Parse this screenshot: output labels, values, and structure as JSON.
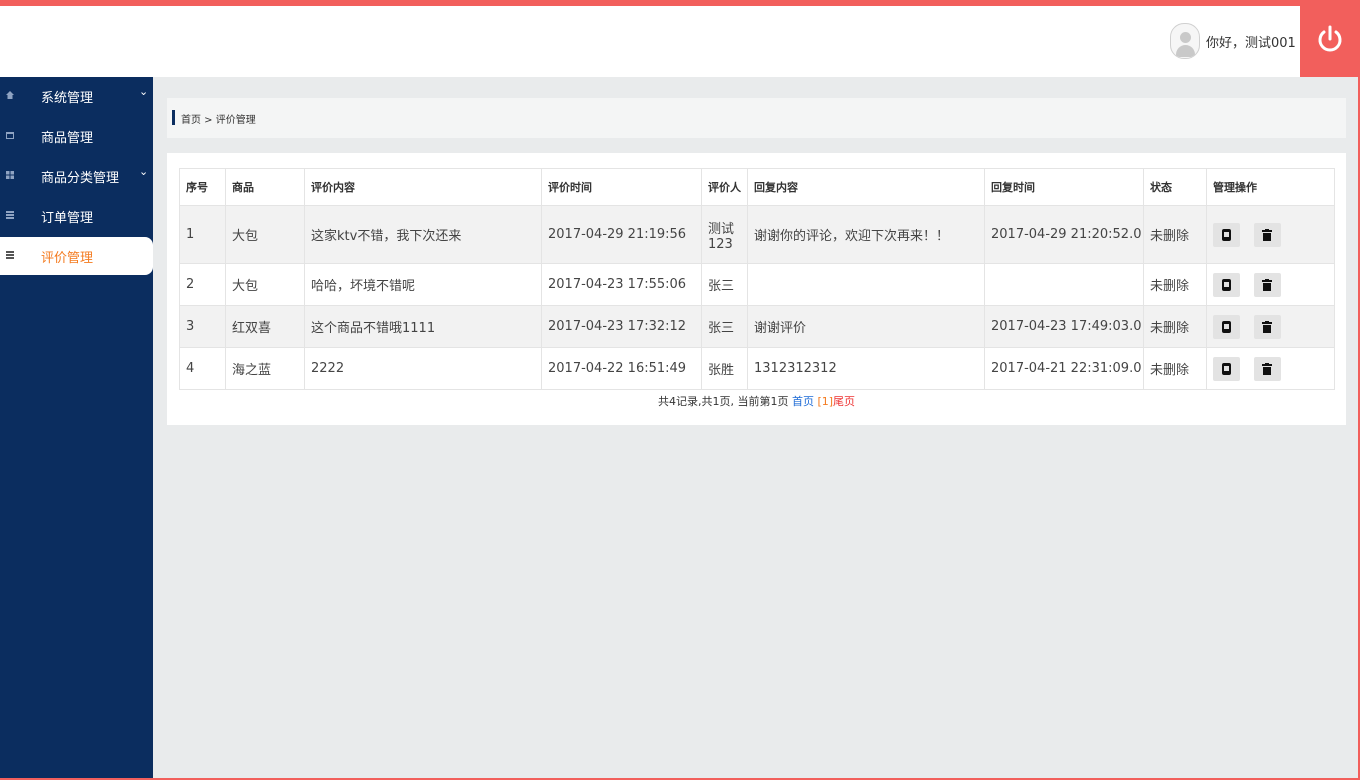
{
  "header": {
    "greeting": "你好，测试001"
  },
  "sidebar": {
    "items": [
      {
        "label": "系统管理",
        "icon": "home-icon",
        "has_submenu": true,
        "active": false
      },
      {
        "label": "商品管理",
        "icon": "calendar-icon",
        "has_submenu": false,
        "active": false
      },
      {
        "label": "商品分类管理",
        "icon": "grid-icon",
        "has_submenu": true,
        "active": false
      },
      {
        "label": "订单管理",
        "icon": "list-icon",
        "has_submenu": false,
        "active": false
      },
      {
        "label": "评价管理",
        "icon": "list-icon",
        "has_submenu": false,
        "active": true
      }
    ]
  },
  "breadcrumb": {
    "text": "首页 > 评价管理"
  },
  "table": {
    "headers": [
      "序号",
      "商品",
      "评价内容",
      "评价时间",
      "评价人",
      "回复内容",
      "回复时间",
      "状态",
      "管理操作"
    ],
    "rows": [
      [
        "1",
        "大包",
        "这家ktv不错，我下次还来",
        "2017-04-29 21:19:56",
        "测试\n123",
        "谢谢你的评论，欢迎下次再来！！",
        "2017-04-29 21:20:52.0",
        "未删除"
      ],
      [
        "2",
        "大包",
        "哈哈，坏境不错呢",
        "2017-04-23 17:55:06",
        "张三",
        "",
        "",
        "未删除"
      ],
      [
        "3",
        "红双喜",
        "这个商品不错哦1111",
        "2017-04-23 17:32:12",
        "张三",
        "谢谢评价",
        "2017-04-23 17:49:03.0",
        "未删除"
      ],
      [
        "4",
        "海之蓝",
        "2222",
        "2017-04-22 16:51:49",
        "张胜",
        "1312312312",
        "2017-04-21 22:31:09.0",
        "未删除"
      ]
    ],
    "actions": [
      "reply-icon",
      "trash-icon"
    ]
  },
  "pager": {
    "summary": "共4记录,共1页, 当前第1页",
    "first": "首页",
    "current": "[1]",
    "last": "尾页"
  },
  "colors": {
    "accent": "#f25f5c",
    "sidebar": "#0b2d5f",
    "active_text": "#f47b20"
  }
}
